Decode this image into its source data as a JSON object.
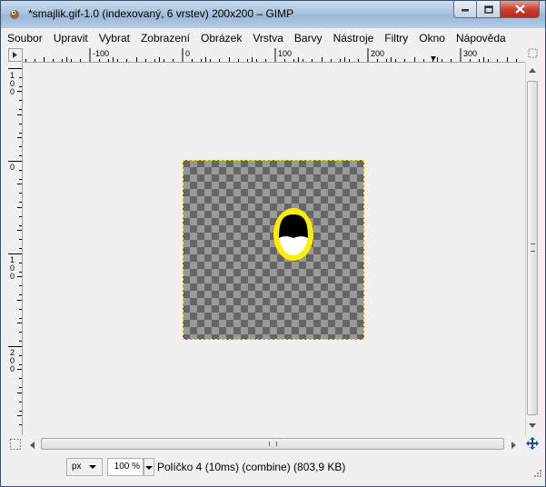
{
  "window": {
    "title": "*smajlik.gif-1.0 (indexovaný, 6 vrstev) 200x200 – GIMP",
    "accent": "#9ab7d6"
  },
  "menu": [
    {
      "label": "Soubor",
      "name": "menu-soubor"
    },
    {
      "label": "Upravit",
      "name": "menu-upravit"
    },
    {
      "label": "Vybrat",
      "name": "menu-vybrat"
    },
    {
      "label": "Zobrazení",
      "name": "menu-zobrazeni"
    },
    {
      "label": "Obrázek",
      "name": "menu-obrazek"
    },
    {
      "label": "Vrstva",
      "name": "menu-vrstva"
    },
    {
      "label": "Barvy",
      "name": "menu-barvy"
    },
    {
      "label": "Nástroje",
      "name": "menu-nastroje"
    },
    {
      "label": "Filtry",
      "name": "menu-filtry"
    },
    {
      "label": "Okno",
      "name": "menu-okno"
    },
    {
      "label": "Nápověda",
      "name": "menu-napoveda"
    }
  ],
  "rulers": {
    "horizontal_labels": [
      "-100",
      "0",
      "100",
      "200",
      "300"
    ],
    "vertical_labels": [
      "100",
      "0",
      "100",
      "200"
    ]
  },
  "status": {
    "unit": "px",
    "zoom": "100 %",
    "text": "Políčko 4 (10ms) (combine) (803,9 KB)"
  },
  "icons": {
    "app": "gimp-wilber-icon",
    "minimize": "minimize-icon",
    "maximize": "maximize-icon",
    "close": "close-icon",
    "navigate": "navigate-cross-icon",
    "quick_mask": "quick-mask-icon",
    "zoom_fit": "zoom-fit-icon"
  },
  "colors": {
    "selection_border": "#ffee00",
    "smiley_outline": "#ffee00",
    "smiley_fill": "#000000"
  }
}
